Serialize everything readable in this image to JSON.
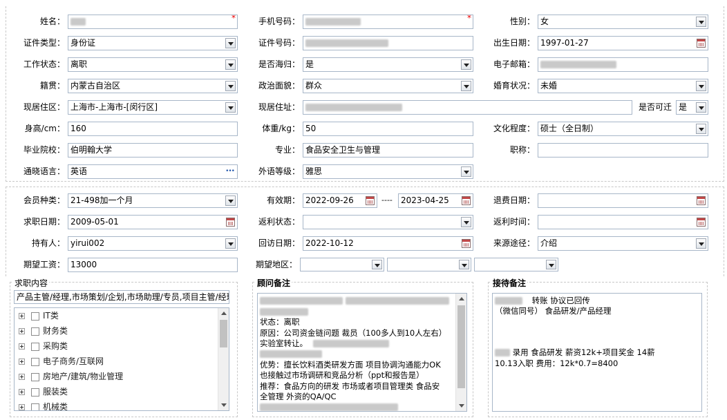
{
  "row1": {
    "name_label": "姓名：",
    "mobile_label": "手机号码：",
    "gender_label": "性别：",
    "gender_value": "女",
    "required_mark": "*"
  },
  "row2": {
    "id_type_label": "证件类型：",
    "id_type_value": "身份证",
    "id_no_label": "证件号码：",
    "birth_label": "出生日期：",
    "birth_value": "1997-01-27"
  },
  "row3": {
    "work_label": "工作状态：",
    "work_value": "离职",
    "overseas_label": "是否海归：",
    "overseas_value": "是",
    "email_label": "电子邮箱："
  },
  "row4": {
    "native_label": "籍贯：",
    "native_value": "内蒙古自治区",
    "politics_label": "政治面貌：",
    "politics_value": "群众",
    "marital_label": "婚育状况：",
    "marital_value": "未婚"
  },
  "row5": {
    "residence_label": "现居住区：",
    "residence_value": "上海市-上海市-[闵行区]",
    "address_label": "现居住址：",
    "relocate_label": "是否可迁",
    "relocate_value": "是"
  },
  "row6": {
    "height_label": "身高/cm：",
    "height_value": "160",
    "weight_label": "体重/kg：",
    "weight_value": "50",
    "edu_label": "文化程度：",
    "edu_value": "硕士（全日制）"
  },
  "row7": {
    "school_label": "毕业院校：",
    "school_value": "伯明翰大学",
    "major_label": "专业：",
    "major_value": "食品安全卫生与管理",
    "title_label": "职称："
  },
  "row8": {
    "lang_label": "通晓语言：",
    "lang_value": "英语",
    "lang_more": "•••",
    "foreign_label": "外语等级：",
    "foreign_value": "雅思"
  },
  "row9": {
    "member_label": "会员种类：",
    "member_value": "21-498加一个月",
    "valid_label": "有效期：",
    "valid_from": "2022-09-26",
    "valid_sep": "----",
    "valid_to": "2023-04-25",
    "refund_label": "退费日期："
  },
  "row10": {
    "jobdate_label": "求职日期：",
    "jobdate_value": "2009-05-01",
    "rebate_status_label": "返利状态：",
    "rebate_time_label": "返利时间："
  },
  "row11": {
    "holder_label": "持有人：",
    "holder_value": "yirui002",
    "visit_label": "回访日期：",
    "visit_value": "2022-10-12",
    "source_label": "来源途径：",
    "source_value": "介绍"
  },
  "row12": {
    "salary_label": "期望工资：",
    "salary_value": "13000",
    "region_label": "期望地区："
  },
  "job_content": {
    "title": "求职内容",
    "summary": "产品主管/经理,市场策划/企划,市场助理/专员,项目主管/经理",
    "tree": [
      "IT类",
      "财务类",
      "采购类",
      "电子商务/互联网",
      "房地产/建筑/物业管理",
      "服装类",
      "机械类"
    ]
  },
  "advisor_note": {
    "title": "顾问备注",
    "lines": [
      "状态：离职",
      "原因：公司资金链问题 裁员（100多人到10人左右）",
      "实验室转让。",
      "优势：擅长饮料酒类研发方面 项目协调沟通能力OK",
      "也接触过市场调研和竞品分析（ppt和报告是）",
      "推荐：食品方向的研发 市场或者项目管理类 食品安",
      "全管理 外资的QA/QC"
    ]
  },
  "reception_note": {
    "title": "接待备注",
    "line1": "转账  协议已回传",
    "line2": "（微信同号） 食品研发/产品经理",
    "line3": "录用 食品研发 薪资12k+项目奖金 14薪",
    "line4": "10.13入职 费用：12k*0.7=8400"
  }
}
